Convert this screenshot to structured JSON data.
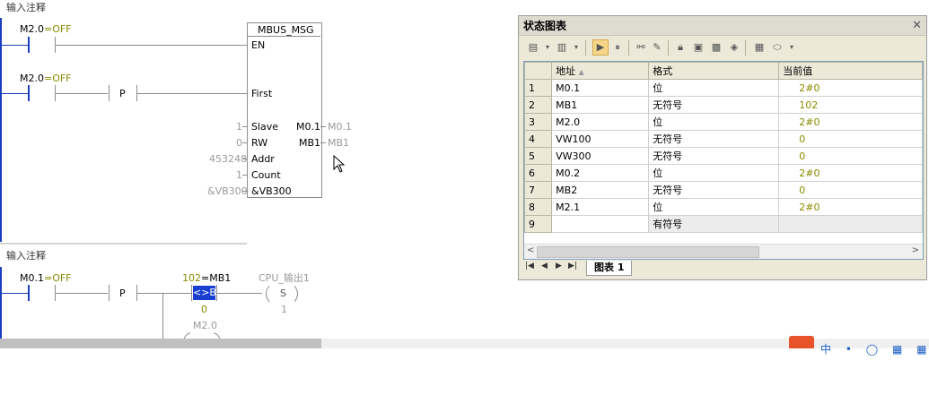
{
  "network1": {
    "comment": "输入注释",
    "contact1_label": "M2.0",
    "contact1_value": "=OFF",
    "contact2_label": "M2.0",
    "contact2_value": "=OFF",
    "p_label": "P",
    "box_title": "MBUS_MSG",
    "pins_left": [
      "EN",
      "First",
      "Slave",
      "RW",
      "Addr",
      "Count",
      "&VB300"
    ],
    "pins_right": [
      "M0.1",
      "MB1"
    ],
    "inputs": [
      "1",
      "0",
      "453248",
      "1",
      "&VB300"
    ],
    "outputs": [
      "M0.1",
      "MB1"
    ]
  },
  "network2": {
    "comment": "输入注释",
    "contact_label": "M0.1",
    "contact_value": "=OFF",
    "p_label": "P",
    "compare_value": "102",
    "compare_label": "=MB1",
    "compare_op": "<>B",
    "compare_rhs": "0",
    "coil_label": "CPU_输出1",
    "coil_type": "S",
    "coil_count": "1",
    "next_label": "M2.0"
  },
  "status_chart": {
    "title": "状态图表",
    "columns": [
      "地址",
      "格式",
      "当前值"
    ],
    "rows": [
      {
        "n": "1",
        "addr": "M0.1",
        "fmt": "位",
        "val": "2#0"
      },
      {
        "n": "2",
        "addr": "MB1",
        "fmt": "无符号",
        "val": "102"
      },
      {
        "n": "3",
        "addr": "M2.0",
        "fmt": "位",
        "val": "2#0"
      },
      {
        "n": "4",
        "addr": "VW100",
        "fmt": "无符号",
        "val": "0"
      },
      {
        "n": "5",
        "addr": "VW300",
        "fmt": "无符号",
        "val": "0"
      },
      {
        "n": "6",
        "addr": "M0.2",
        "fmt": "位",
        "val": "2#0"
      },
      {
        "n": "7",
        "addr": "MB2",
        "fmt": "无符号",
        "val": "0"
      },
      {
        "n": "8",
        "addr": "M2.1",
        "fmt": "位",
        "val": "2#0"
      },
      {
        "n": "9",
        "addr": "",
        "fmt": "有符号",
        "val": ""
      }
    ],
    "tab_label": "图表 1"
  },
  "colors": {
    "rail": "#1c3fbf",
    "value": "#8a8a00",
    "highlight": "#1a3fd0"
  }
}
